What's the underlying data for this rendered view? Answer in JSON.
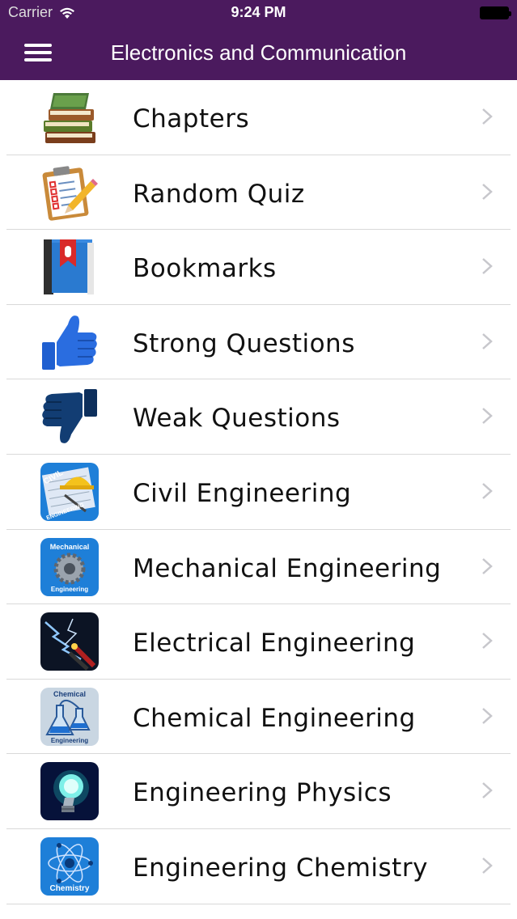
{
  "status_bar": {
    "carrier": "Carrier",
    "time": "9:24 PM"
  },
  "nav_bar": {
    "title": "Electronics and Communication",
    "menu_icon": "hamburger-icon"
  },
  "colors": {
    "header": "#4b1a5e",
    "divider": "#d9d9d9",
    "chevron": "#c7c7cc"
  },
  "menu": {
    "items": [
      {
        "label": "Chapters",
        "icon": "books-icon"
      },
      {
        "label": "Random Quiz",
        "icon": "clipboard-icon"
      },
      {
        "label": "Bookmarks",
        "icon": "bookmark-book-icon"
      },
      {
        "label": "Strong Questions",
        "icon": "thumbs-up-icon"
      },
      {
        "label": "Weak Questions",
        "icon": "thumbs-down-icon"
      },
      {
        "label": "Civil Engineering",
        "icon": "civil-engineering-icon",
        "badge_top": "CIVIL",
        "badge_bottom": "ENGINEERING"
      },
      {
        "label": "Mechanical Engineering",
        "icon": "mechanical-engineering-icon",
        "badge_top": "Mechanical",
        "badge_bottom": "Engineering"
      },
      {
        "label": "Electrical Engineering",
        "icon": "electrical-engineering-icon"
      },
      {
        "label": "Chemical Engineering",
        "icon": "chemical-engineering-icon",
        "badge_top": "Chemical",
        "badge_bottom": "Engineering"
      },
      {
        "label": "Engineering Physics",
        "icon": "lightbulb-icon"
      },
      {
        "label": "Engineering Chemistry",
        "icon": "atom-icon",
        "badge_bottom": "Chemistry"
      }
    ]
  }
}
